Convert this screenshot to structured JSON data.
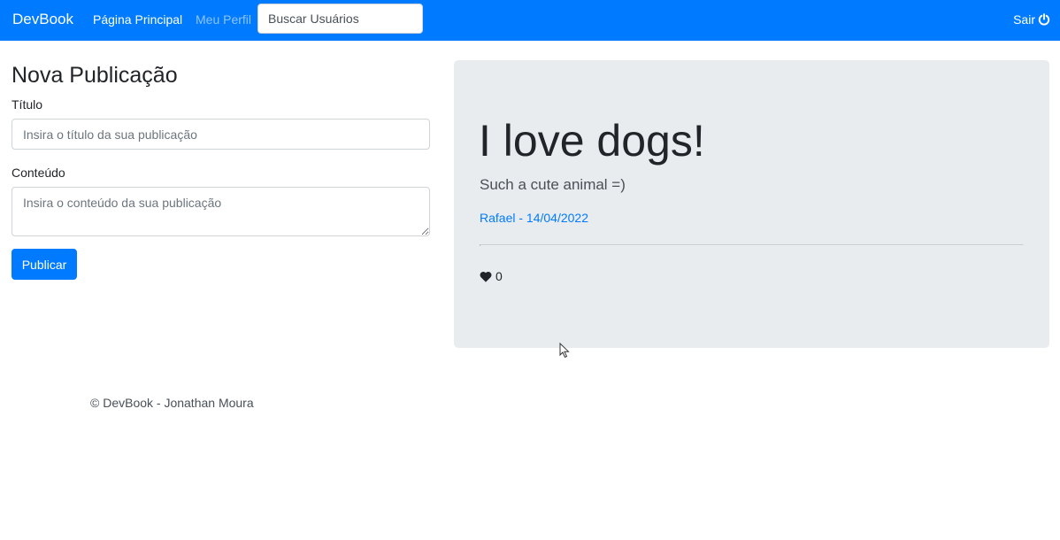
{
  "navbar": {
    "brand": "DevBook",
    "links": [
      {
        "label": "Página Principal"
      },
      {
        "label": "Meu Perfil"
      }
    ],
    "search": {
      "placeholder": "Buscar Usuários",
      "value": ""
    },
    "logout": {
      "label": "Sair",
      "icon": "power-icon"
    }
  },
  "form": {
    "title": "Nova Publicação",
    "title_field": {
      "label": "Título",
      "placeholder": "Insira o título da sua publicação",
      "value": ""
    },
    "content_field": {
      "label": "Conteúdo",
      "placeholder": "Insira o conteúdo da sua publicação",
      "value": ""
    },
    "submit_label": "Publicar"
  },
  "publication": {
    "title": "I love dogs!",
    "content": "Such a cute animal =)",
    "author_date": "Rafael - 14/04/2022",
    "likes": "0",
    "like_icon": "heart-icon"
  },
  "footer": {
    "text": "© DevBook - Jonathan Moura"
  },
  "colors": {
    "primary": "#007bff",
    "card_background": "#e9ecef",
    "inactive_link": "#80bdff"
  }
}
